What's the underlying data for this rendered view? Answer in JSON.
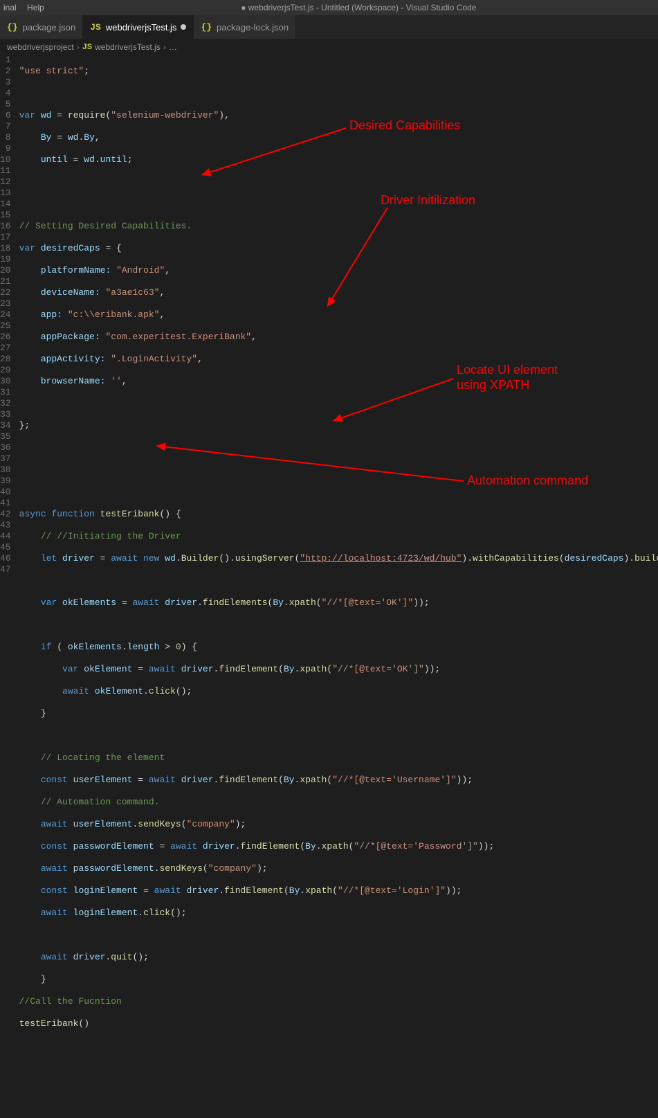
{
  "window": {
    "title": "● webdriverjsTest.js - Untitled (Workspace) - Visual Studio Code"
  },
  "menubar": {
    "terminal": "inal",
    "help": "Help"
  },
  "tabs": {
    "t0": {
      "label": "package.json"
    },
    "t1": {
      "label": "webdriverjsTest.js"
    },
    "t2": {
      "label": "package-lock.json"
    }
  },
  "breadcrumb": {
    "folder": "webdriverjsproject",
    "file": "webdriverjsTest.js",
    "symbol": "…"
  },
  "icons": {
    "js": "JS",
    "json": "{}"
  },
  "annotations": {
    "a1": "Desired Capabilities",
    "a2": "Driver Initilization",
    "a3a": "Locate UI element",
    "a3b": "using XPATH",
    "a4": "Automation command"
  },
  "gutter": {
    "1": "1",
    "2": "2",
    "3": "3",
    "4": "4",
    "5": "5",
    "6": "6",
    "7": "7",
    "8": "8",
    "9": "9",
    "10": "10",
    "11": "11",
    "12": "12",
    "13": "13",
    "14": "14",
    "15": "15",
    "16": "16",
    "17": "17",
    "18": "18",
    "19": "19",
    "20": "20",
    "21": "21",
    "22": "22",
    "23": "23",
    "24": "24",
    "25": "25",
    "26": "26",
    "27": "27",
    "28": "28",
    "29": "29",
    "30": "30",
    "31": "31",
    "32": "32",
    "33": "33",
    "34": "34",
    "35": "35",
    "36": "36",
    "37": "37",
    "38": "38",
    "39": "39",
    "40": "40",
    "41": "41",
    "42": "42",
    "43": "43",
    "44": "44",
    "45": "45",
    "46": "46",
    "47": "47"
  },
  "code": {
    "l1": {
      "a": "\"use strict\"",
      "b": ";"
    },
    "l2": {
      "a": ""
    },
    "l3": {
      "a": "var",
      "b": " wd",
      "c": " = ",
      "d": "require",
      "e": "(",
      "f": "\"selenium-webdriver\"",
      "g": "),"
    },
    "l4": {
      "a": "    ",
      "b": "By",
      "c": " = ",
      "d": "wd",
      "e": ".",
      "f": "By",
      "g": ","
    },
    "l5": {
      "a": "    ",
      "b": "until",
      "c": " = ",
      "d": "wd",
      "e": ".",
      "f": "until",
      "g": ";"
    },
    "l6": {
      "a": ""
    },
    "l7": {
      "a": ""
    },
    "l8": {
      "a": "// Setting Desired Capabilities."
    },
    "l9": {
      "a": "var",
      "b": " desiredCaps",
      "c": " = {"
    },
    "l10": {
      "a": "    ",
      "b": "platformName:",
      "c": " ",
      "d": "\"Android\"",
      "e": ","
    },
    "l11": {
      "a": "    ",
      "b": "deviceName:",
      "c": " ",
      "d": "\"a3ae1c63\"",
      "e": ","
    },
    "l12": {
      "a": "    ",
      "b": "app:",
      "c": " ",
      "d": "\"c:\\\\eribank.apk\"",
      "e": ","
    },
    "l13": {
      "a": "    ",
      "b": "appPackage:",
      "c": " ",
      "d": "\"com.experitest.ExperiBank\"",
      "e": ","
    },
    "l14": {
      "a": "    ",
      "b": "appActivity:",
      "c": " ",
      "d": "\".LoginActivity\"",
      "e": ","
    },
    "l15": {
      "a": "    ",
      "b": "browserName:",
      "c": " ",
      "d": "''",
      "e": ","
    },
    "l16": {
      "a": ""
    },
    "l17": {
      "a": "};"
    },
    "l18": {
      "a": ""
    },
    "l19": {
      "a": ""
    },
    "l20": {
      "a": ""
    },
    "l21": {
      "a": "async",
      "b": " function",
      "c": " ",
      "d": "testEribank",
      "e": "() {"
    },
    "l22": {
      "a": "    ",
      "b": "// //Initiating the Driver"
    },
    "l23": {
      "a": "    ",
      "b": "let",
      "c": " driver",
      "d": " = ",
      "e": "await",
      "f": " ",
      "g": "new",
      "h": " ",
      "i": "wd",
      "j": ".",
      "k": "Builder",
      "l": "().",
      "m": "usingServer",
      "n": "(",
      "o": "\"http://localhost:4723/wd/hub\"",
      "p": ").",
      "q": "withCapabilities",
      "r": "(",
      "s": "desiredCaps",
      "t": ").",
      "u": "build",
      "v": "();"
    },
    "l24": {
      "a": ""
    },
    "l25": {
      "a": "    ",
      "b": "var",
      "c": " okElements",
      "d": " = ",
      "e": "await",
      "f": " ",
      "g": "driver",
      "h": ".",
      "i": "findElements",
      "j": "(",
      "k": "By",
      "l": ".",
      "m": "xpath",
      "n": "(",
      "o": "\"//*[@text='OK']\"",
      "p": "));"
    },
    "l26": {
      "a": ""
    },
    "l27": {
      "a": "    ",
      "b": "if",
      "c": " ( ",
      "d": "okElements",
      "e": ".",
      "f": "length",
      "g": " > ",
      "h": "0",
      "i": ") {"
    },
    "l28": {
      "a": "        ",
      "b": "var",
      "c": " okElement",
      "d": " = ",
      "e": "await",
      "f": " ",
      "g": "driver",
      "h": ".",
      "i": "findElement",
      "j": "(",
      "k": "By",
      "l": ".",
      "m": "xpath",
      "n": "(",
      "o": "\"//*[@text='OK']\"",
      "p": "));"
    },
    "l29": {
      "a": "        ",
      "b": "await",
      "c": " ",
      "d": "okElement",
      "e": ".",
      "f": "click",
      "g": "();"
    },
    "l30": {
      "a": "    }"
    },
    "l31": {
      "a": ""
    },
    "l32": {
      "a": "    ",
      "b": "// Locating the element"
    },
    "l33": {
      "a": "    ",
      "b": "const",
      "c": " userElement",
      "d": " = ",
      "e": "await",
      "f": " ",
      "g": "driver",
      "h": ".",
      "i": "findElement",
      "j": "(",
      "k": "By",
      "l": ".",
      "m": "xpath",
      "n": "(",
      "o": "\"//*[@text='Username']\"",
      "p": "));"
    },
    "l34": {
      "a": "    ",
      "b": "// Automation command."
    },
    "l35": {
      "a": "    ",
      "b": "await",
      "c": " ",
      "d": "userElement",
      "e": ".",
      "f": "sendKeys",
      "g": "(",
      "h": "\"company\"",
      "i": ");"
    },
    "l36": {
      "a": "    ",
      "b": "const",
      "c": " passwordElement",
      "d": " = ",
      "e": "await",
      "f": " ",
      "g": "driver",
      "h": ".",
      "i": "findElement",
      "j": "(",
      "k": "By",
      "l": ".",
      "m": "xpath",
      "n": "(",
      "o": "\"//*[@text='Password']\"",
      "p": "));"
    },
    "l37": {
      "a": "    ",
      "b": "await",
      "c": " ",
      "d": "passwordElement",
      "e": ".",
      "f": "sendKeys",
      "g": "(",
      "h": "\"company\"",
      "i": ");"
    },
    "l38": {
      "a": "    ",
      "b": "const",
      "c": " loginElement",
      "d": " = ",
      "e": "await",
      "f": " ",
      "g": "driver",
      "h": ".",
      "i": "findElement",
      "j": "(",
      "k": "By",
      "l": ".",
      "m": "xpath",
      "n": "(",
      "o": "\"//*[@text='Login']\"",
      "p": "));"
    },
    "l39": {
      "a": "    ",
      "b": "await",
      "c": " ",
      "d": "loginElement",
      "e": ".",
      "f": "click",
      "g": "();"
    },
    "l40": {
      "a": ""
    },
    "l41": {
      "a": "    ",
      "b": "await",
      "c": " ",
      "d": "driver",
      "e": ".",
      "f": "quit",
      "g": "();"
    },
    "l42": {
      "a": "    }"
    },
    "l43": {
      "a": "//Call the Fucntion"
    },
    "l44": {
      "a": "testEribank",
      "b": "()"
    },
    "l45": {
      "a": ""
    },
    "l46": {
      "a": ""
    },
    "l47": {
      "a": ""
    }
  }
}
